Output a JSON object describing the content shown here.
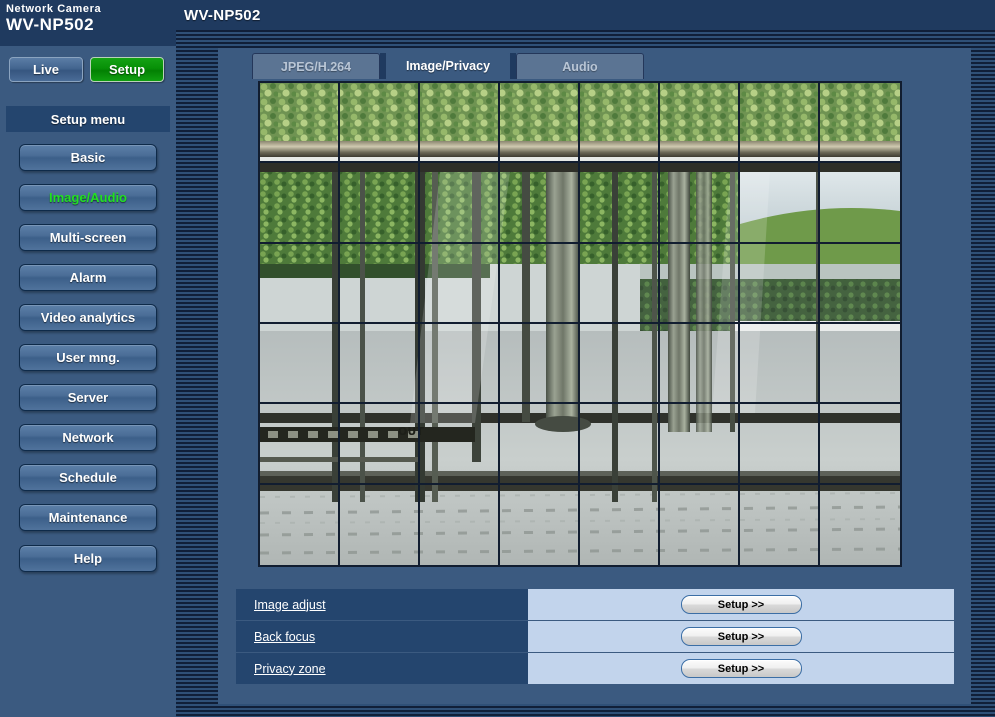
{
  "sidebar": {
    "brand": {
      "subtitle": "Network Camera",
      "model": "WV-NP502"
    },
    "mode_buttons": [
      {
        "label": "Live",
        "state": "inactive"
      },
      {
        "label": "Setup",
        "state": "active"
      }
    ],
    "menu_header": "Setup menu",
    "items": [
      {
        "label": "Basic",
        "active": false
      },
      {
        "label": "Image/Audio",
        "active": true
      },
      {
        "label": "Multi-screen",
        "active": false
      },
      {
        "label": "Alarm",
        "active": false
      },
      {
        "label": "Video analytics",
        "active": false
      },
      {
        "label": "User mng.",
        "active": false
      },
      {
        "label": "Server",
        "active": false
      },
      {
        "label": "Network",
        "active": false
      },
      {
        "label": "Schedule",
        "active": false
      },
      {
        "label": "Maintenance",
        "active": false
      }
    ],
    "help": {
      "label": "Help"
    }
  },
  "main": {
    "title": "WV-NP502",
    "tabs": [
      {
        "label": "JPEG/H.264",
        "active": false
      },
      {
        "label": "Image/Privacy",
        "active": true
      },
      {
        "label": "Audio",
        "active": false
      }
    ],
    "preview": {
      "name": "camera-live-preview",
      "grid_columns": 8,
      "grid_rows": 6,
      "grid_line_color": "#111d30",
      "description": "Live camera view of a glass-walled building entrance with ivy hedge above, wet paved plaza and reflective metal pillars, divided by a privacy-zone selection grid"
    },
    "settings_rows": [
      {
        "label": "Image adjust",
        "button": "Setup >>"
      },
      {
        "label": "Back focus",
        "button": "Setup >>"
      },
      {
        "label": "Privacy zone",
        "button": "Setup >>"
      }
    ]
  },
  "colors": {
    "page_background": "#1f3a5f",
    "sidebar_background": "#3b5a80",
    "panel_background": "#3b5a80",
    "header_bar": "#24456e",
    "value_cell": "#c2d4ec",
    "active_menu_text": "#22e022",
    "setup_button_green": "#079007"
  }
}
